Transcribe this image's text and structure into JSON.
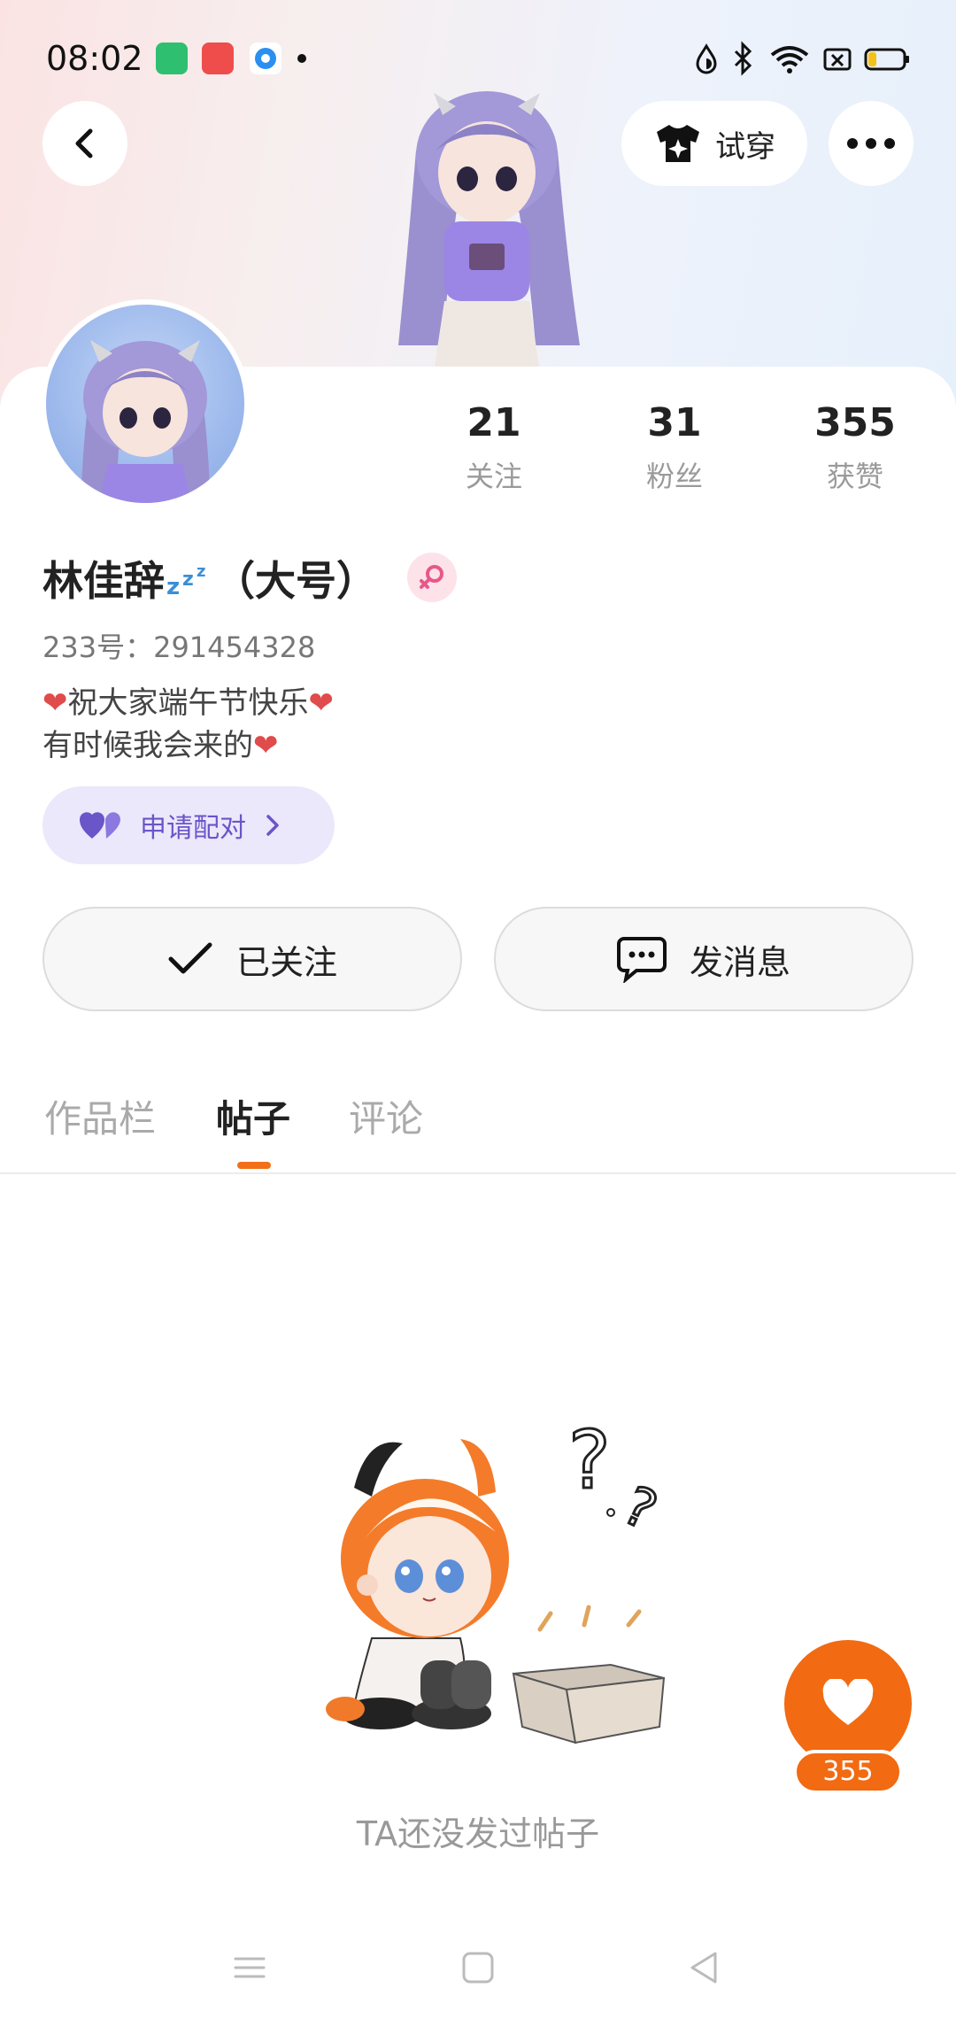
{
  "status_bar": {
    "time": "08:02",
    "app_icons": [
      {
        "name": "battery-app-icon",
        "color": "#2fbf71"
      },
      {
        "name": "camera-app-icon",
        "color": "#ef4c4c"
      },
      {
        "name": "browser-app-icon",
        "color": "#2a8ff0"
      }
    ],
    "right_icons": [
      "data-saver-icon",
      "bluetooth-icon",
      "wifi-icon",
      "no-sim-icon",
      "battery-icon"
    ]
  },
  "header": {
    "back_icon": "chevron-left-icon",
    "tryon_label": "试穿",
    "more_icon": "more-icon"
  },
  "profile": {
    "stats": [
      {
        "value": "21",
        "label": "关注"
      },
      {
        "value": "31",
        "label": "粉丝"
      },
      {
        "value": "355",
        "label": "获赞"
      }
    ],
    "nickname": "林佳辞",
    "nickname_suffix": "（大号）",
    "uid": "233号：291454328",
    "bio_line1": "祝大家端午节快乐",
    "bio_line2": "有时候我会来的",
    "pair_label": "申请配对"
  },
  "actions": {
    "follow_label": "已关注",
    "message_label": "发消息"
  },
  "tabs": [
    {
      "label": "作品栏",
      "active": false
    },
    {
      "label": "帖子",
      "active": true
    },
    {
      "label": "评论",
      "active": false
    }
  ],
  "empty_state": {
    "text": "TA还没发过帖子"
  },
  "like_button": {
    "count": "355"
  },
  "colors": {
    "accent": "#f26a12",
    "pair": "#6a55c9"
  }
}
